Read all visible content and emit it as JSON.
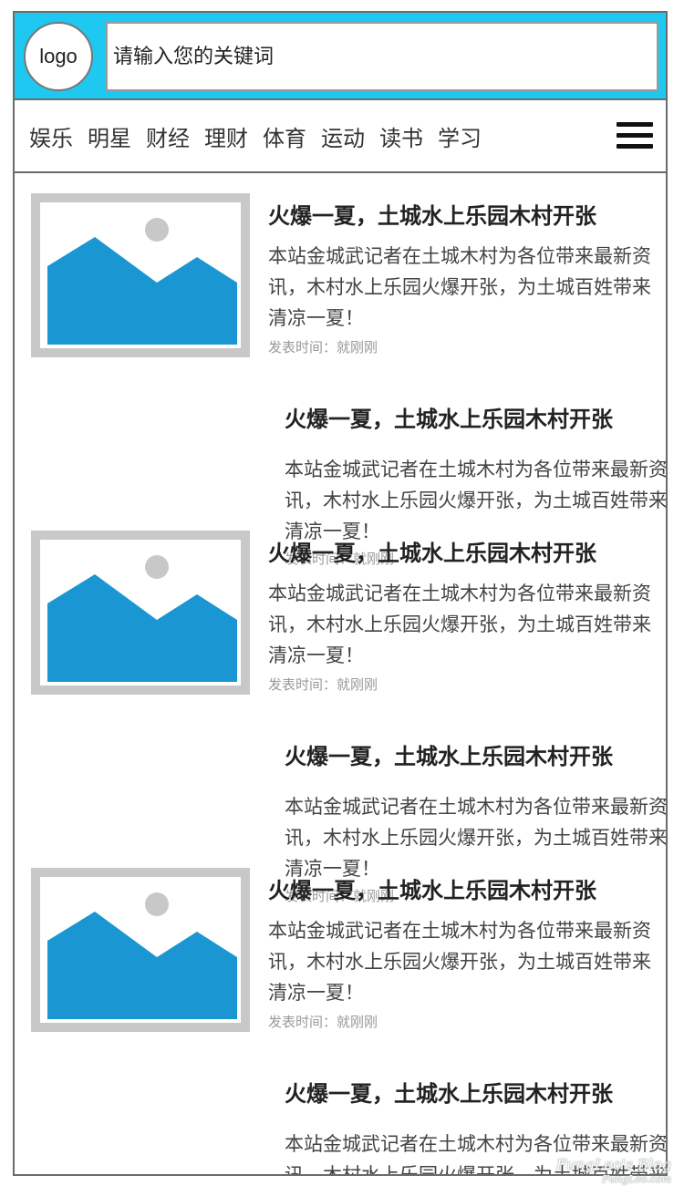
{
  "header": {
    "logo_text": "logo",
    "search_placeholder": "请输入您的关键词",
    "header_color": "#1ec8f0"
  },
  "nav": {
    "items": [
      "娱乐",
      "明星",
      "财经",
      "理财",
      "体育",
      "运动",
      "读书",
      "学习"
    ],
    "menu_icon": "hamburger-menu-icon"
  },
  "articles": [
    {
      "layout": "image",
      "title": "火爆一夏，土城水上乐园木村开张",
      "summary": "本站金城武记者在土城木村为各位带来最新资讯，木村水上乐园火爆开张，为土城百姓带来清凉一夏！",
      "meta": "发表时间：就刚刚"
    },
    {
      "layout": "text",
      "title": "火爆一夏，土城水上乐园木村开张",
      "summary": "本站金城武记者在土城木村为各位带来最新资讯，木村水上乐园火爆开张，为土城百姓带来清凉一夏！",
      "meta": "发表时间：就刚刚"
    },
    {
      "layout": "image",
      "title": "火爆一夏，土城水上乐园木村开张",
      "summary": "本站金城武记者在土城木村为各位带来最新资讯，木村水上乐园火爆开张，为土城百姓带来清凉一夏！",
      "meta": "发表时间：就刚刚"
    },
    {
      "layout": "text",
      "title": "火爆一夏，土城水上乐园木村开张",
      "summary": "本站金城武记者在土城木村为各位带来最新资讯，木村水上乐园火爆开张，为土城百姓带来清凉一夏！",
      "meta": "发表时间：就刚刚"
    },
    {
      "layout": "image",
      "title": "火爆一夏，土城水上乐园木村开张",
      "summary": "本站金城武记者在土城木村为各位带来最新资讯，木村水上乐园火爆开张，为土城百姓带来清凉一夏！",
      "meta": "发表时间：就刚刚"
    },
    {
      "layout": "text",
      "title": "火爆一夏，土城水上乐园木村开张",
      "summary": "本站金城武记者在土城木村为各位带来最新资讯，木村水上乐园火爆开张，为土城百姓带来清凉一夏！",
      "meta": ""
    }
  ],
  "thumbnail": {
    "icon": "image-placeholder-icon",
    "frame_color": "#c8c8c8",
    "mountain_color": "#1a97d2",
    "sun_color": "#c8c8c8"
  },
  "watermark": {
    "line1": "FungLeo's Blog",
    "line2": "FungLeo.com"
  }
}
